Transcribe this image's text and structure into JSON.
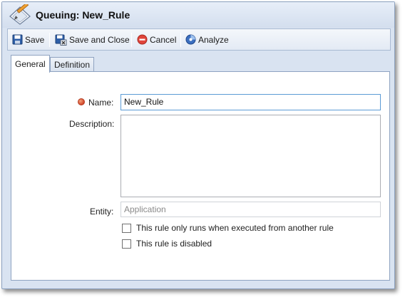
{
  "window": {
    "title": "Queuing: New_Rule",
    "icon": "edit-document-icon"
  },
  "toolbar": {
    "save_label": "Save",
    "save_close_label": "Save and Close",
    "cancel_label": "Cancel",
    "analyze_label": "Analyze"
  },
  "tabs": [
    {
      "label": "General",
      "active": true
    },
    {
      "label": "Definition",
      "active": false
    }
  ],
  "form": {
    "name_label": "Name:",
    "name_value": "New_Rule",
    "name_required": true,
    "description_label": "Description:",
    "description_value": "",
    "entity_label": "Entity:",
    "entity_placeholder": "Application",
    "checkbox_executed_label": "This rule only runs when executed from another rule",
    "checkbox_executed_checked": false,
    "checkbox_disabled_label": "This rule is disabled",
    "checkbox_disabled_checked": false
  },
  "colors": {
    "window_bg": "#d9e3f1",
    "border": "#8fa3c1",
    "required_dot": "#d2472a",
    "focus_border": "#5b9bd5"
  }
}
